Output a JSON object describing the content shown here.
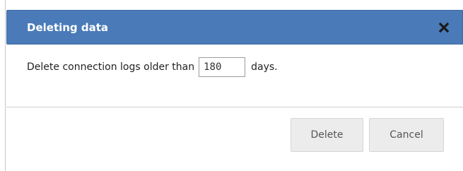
{
  "dialog": {
    "title": "Deleting data",
    "close_icon": "close-x-icon",
    "body": {
      "prefix": "Delete connection logs older than",
      "days_value": "180",
      "suffix": "days."
    },
    "buttons": {
      "delete": "Delete",
      "cancel": "Cancel"
    }
  },
  "colors": {
    "titlebar": "#4a7ab8",
    "title_text": "#ffffff",
    "button_bg": "#ececec",
    "divider": "#cfcfcf"
  }
}
